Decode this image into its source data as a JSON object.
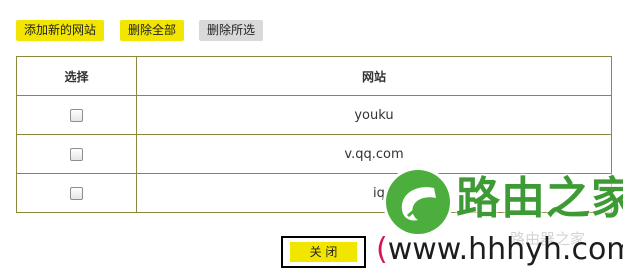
{
  "toolbar": {
    "add_label": "添加新的网站",
    "delete_all_label": "删除全部",
    "delete_selected_label": "删除所选"
  },
  "table": {
    "headers": [
      "选择",
      "网站"
    ],
    "rows": [
      {
        "site": "youku",
        "checked": false
      },
      {
        "site": "v.qq.com",
        "checked": false
      },
      {
        "site": "iqiyi",
        "checked": false
      }
    ]
  },
  "footer": {
    "close_label": "关 闭"
  },
  "watermark": {
    "logo_icon": "leaf-logo-icon",
    "title": "路由之家",
    "url_open": "(",
    "url": "www.hhhyh.com",
    "url_close": ")",
    "faded_text": "路由器之家"
  },
  "colors": {
    "button_yellow": "#f2e600",
    "button_gray": "#d9d9d9",
    "table_border": "#8a8a3a",
    "watermark_green": "#3e9a35",
    "watermark_paren": "#d4145a"
  }
}
